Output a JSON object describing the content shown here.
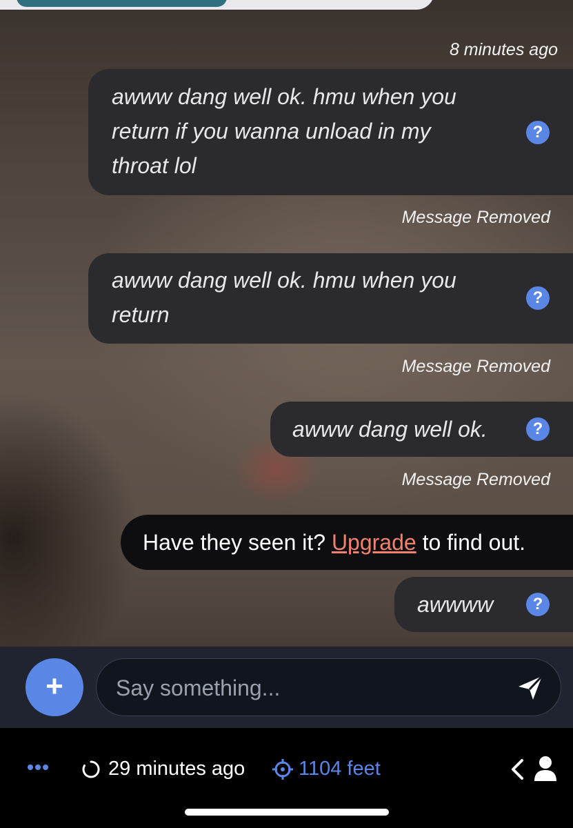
{
  "thread": {
    "timestamp": "8 minutes ago",
    "messages": [
      {
        "lines": [
          "awww dang well ok. hmu when you",
          "return if you wanna unload in my",
          "throat lol"
        ],
        "icon": "question-icon",
        "status": "Message Removed"
      },
      {
        "lines": [
          "awww dang well ok. hmu when you",
          "return"
        ],
        "icon": "question-icon",
        "status": "Message Removed"
      },
      {
        "lines": [
          "awww dang well ok."
        ],
        "icon": "question-icon",
        "status": "Message Removed"
      }
    ],
    "upsell": {
      "before": "Have they seen it? ",
      "link": "Upgrade",
      "after": " to find out."
    },
    "last_message": {
      "text": "awwww",
      "icon": "question-icon"
    }
  },
  "composer": {
    "add_label": "+",
    "placeholder": "Say something...",
    "send_icon": "send-icon"
  },
  "footer": {
    "more_icon": "more-dots-icon",
    "last_active": "29 minutes ago",
    "distance": "1104 feet",
    "back_icon": "chevron-left-icon",
    "profile_icon": "person-icon"
  },
  "colors": {
    "accent": "#5a86e6",
    "link": "#f0826e",
    "bubble": "#2b2a2e",
    "upsell_bg": "#0e0e10",
    "footer_bg": "#000000"
  }
}
